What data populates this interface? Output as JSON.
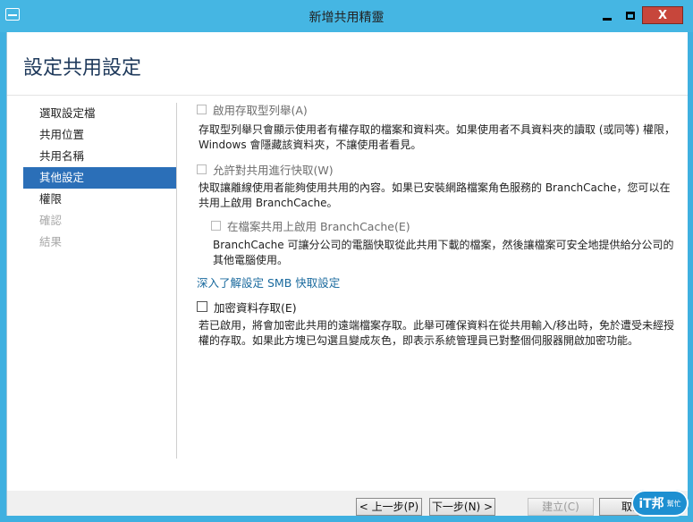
{
  "window": {
    "title": "新增共用精靈",
    "minimize_icon": "minimize-icon",
    "maximize_icon": "maximize-icon",
    "close_label": "X"
  },
  "page": {
    "title": "設定共用設定"
  },
  "nav": {
    "items": [
      {
        "label": "選取設定檔",
        "state": "normal"
      },
      {
        "label": "共用位置",
        "state": "normal"
      },
      {
        "label": "共用名稱",
        "state": "normal"
      },
      {
        "label": "其他設定",
        "state": "active"
      },
      {
        "label": "權限",
        "state": "normal"
      },
      {
        "label": "確認",
        "state": "disabled"
      },
      {
        "label": "結果",
        "state": "disabled"
      }
    ]
  },
  "options": {
    "access_based": {
      "label": "啟用存取型列舉(A)",
      "checked": false,
      "enabled": false,
      "description": "存取型列舉只會顯示使用者有權存取的檔案和資料夾。如果使用者不具資料夾的讀取 (或同等) 權限，Windows 會隱藏該資料夾，不讓使用者看見。"
    },
    "caching": {
      "label": "允許對共用進行快取(W)",
      "checked": false,
      "enabled": false,
      "description": "快取讓離線使用者能夠使用共用的內容。如果已安裝網路檔案角色服務的 BranchCache，您可以在共用上啟用 BranchCache。"
    },
    "branchcache": {
      "label": "在檔案共用上啟用 BranchCache(E)",
      "checked": false,
      "enabled": false,
      "description": "BranchCache 可讓分公司的電腦快取從此共用下載的檔案，然後讓檔案可安全地提供給分公司的其他電腦使用。"
    },
    "smb_link": "深入了解設定 SMB 快取設定",
    "encrypt": {
      "label": "加密資料存取(E)",
      "checked": false,
      "enabled": true,
      "description": "若已啟用，將會加密此共用的遠端檔案存取。此舉可確保資料在從共用輸入/移出時，免於遭受未經授權的存取。如果此方塊已勾選且變成灰色，即表示系統管理員已對整個伺服器開啟加密功能。"
    }
  },
  "buttons": {
    "previous": "< 上一步(P)",
    "next": "下一步(N) >",
    "create": "建立(C)",
    "cancel": "取消"
  },
  "watermark": {
    "text": "iT邦",
    "sub": "幫忙"
  }
}
